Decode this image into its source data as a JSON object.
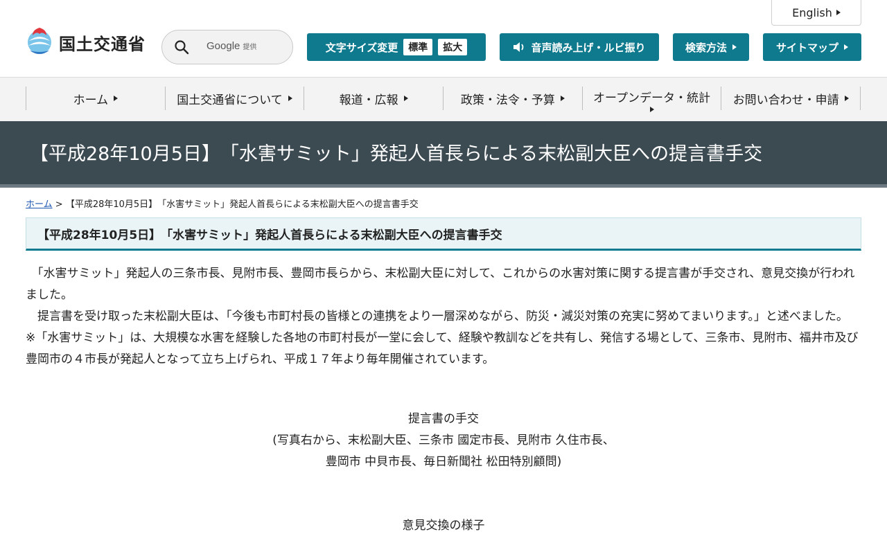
{
  "header": {
    "english_label": "English",
    "logo_text": "国土交通省",
    "search": {
      "placeholder": "",
      "provider_name": "Google",
      "provider_suffix": "提供"
    },
    "text_size": {
      "label": "文字サイズ変更",
      "standard": "標準",
      "large": "拡大"
    },
    "speech_label": "音声読み上げ・ルビ振り",
    "search_method_label": "検索方法",
    "sitemap_label": "サイトマップ"
  },
  "nav": {
    "items": [
      {
        "label": "ホーム"
      },
      {
        "label": "国土交通省について"
      },
      {
        "label": "報道・広報"
      },
      {
        "label": "政策・法令・予算"
      },
      {
        "label": "オープンデータ・統計"
      },
      {
        "label": "お問い合わせ・申請"
      }
    ]
  },
  "page": {
    "title": "【平成28年10月5日】　「水害サミット」発起人首長らによる末松副大臣への提言書手交",
    "breadcrumb": {
      "home": "ホーム",
      "separator": ">",
      "current": "【平成28年10月5日】　「水害サミット」発起人首長らによる末松副大臣への提言書手交"
    },
    "heading": "【平成28年10月5日】　「水害サミット」発起人首長らによる末松副大臣への提言書手交",
    "paragraphs": [
      "　「水害サミット」発起人の三条市長、見附市長、豊岡市長らから、末松副大臣に対して、これからの水害対策に関する提言書が手交され、意見交換が行われました。",
      "　提言書を受け取った末松副大臣は、「今後も市町村長の皆様との連携をより一層深めながら、防災・減災対策の充実に努めてまいります。」と述べました。",
      "※「水害サミット」は、大規模な水害を経験した各地の市町村長が一堂に会して、経験や教訓などを共有し、発信する場として、三条市、見附市、福井市及び豊岡市の４市長が発起人となって立ち上げられ、平成１７年より毎年開催されています。"
    ],
    "caption1": {
      "line1": "提言書の手交",
      "line2": "(写真右から、末松副大臣、三条市 國定市長、見附市 久住市長、",
      "line3": "豊岡市 中貝市長、毎日新聞社 松田特別顧問)"
    },
    "caption2": "意見交換の様子"
  },
  "colors": {
    "accent": "#0f7a8e",
    "title_band": "#3c4a52",
    "nav_bg": "#f3f3f3",
    "heading_bg": "#eaf4f6",
    "link": "#1a56b0"
  },
  "icons": [
    "mlit-logo-icon",
    "search-icon",
    "speaker-icon",
    "triangle-right-icon"
  ]
}
